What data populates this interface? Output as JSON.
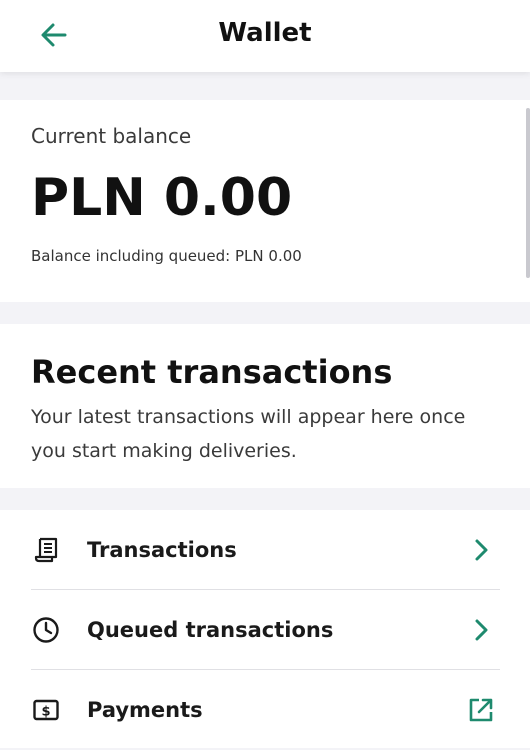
{
  "header": {
    "title": "Wallet",
    "back_icon": "arrow-left-icon"
  },
  "balance": {
    "label": "Current balance",
    "amount": "PLN 0.00",
    "including_queued": "Balance including queued: PLN 0.00"
  },
  "recent": {
    "title": "Recent transactions",
    "description": "Your latest transactions will appear here once you start making deliveries."
  },
  "menu": {
    "items": [
      {
        "label": "Transactions",
        "icon": "receipt-icon",
        "trailing": "chevron-right-icon"
      },
      {
        "label": "Queued transactions",
        "icon": "clock-icon",
        "trailing": "chevron-right-icon"
      },
      {
        "label": "Payments",
        "icon": "payments-icon",
        "trailing": "external-link-icon"
      }
    ]
  },
  "colors": {
    "accent": "#1e8a6e",
    "background": "#f3f3f7",
    "card": "#ffffff",
    "text": "#1c1c1c"
  }
}
